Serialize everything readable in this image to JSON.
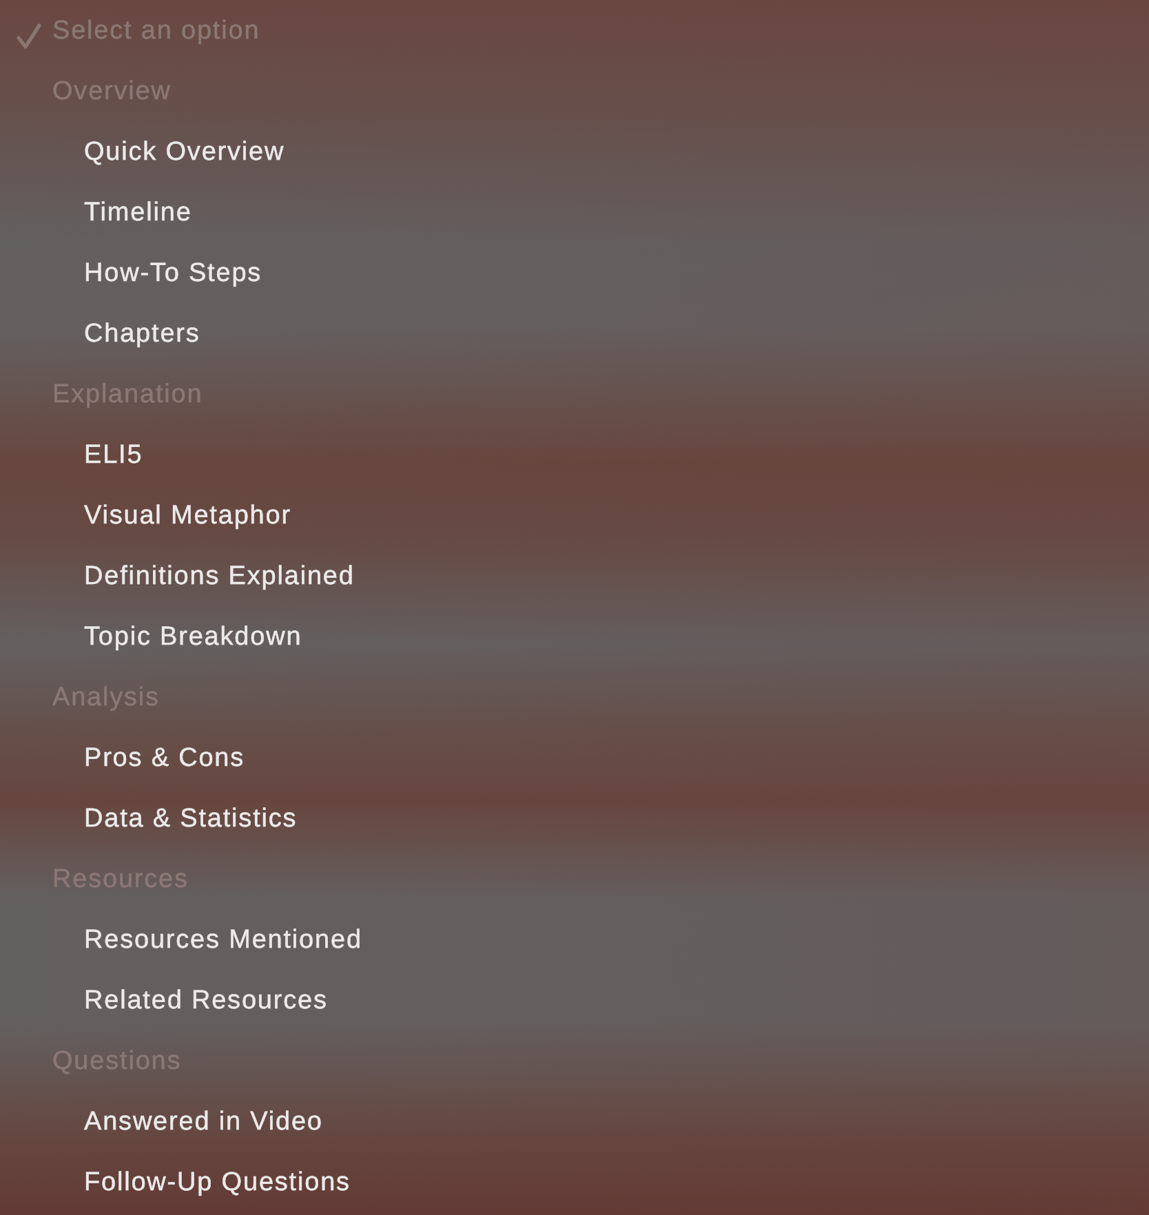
{
  "menu": {
    "placeholder": {
      "label": "Select an option",
      "selected": true,
      "disabled": true
    },
    "groups": [
      {
        "label": "Overview",
        "options": [
          {
            "label": "Quick Overview",
            "selected": false
          },
          {
            "label": "Timeline",
            "selected": false
          },
          {
            "label": "How-To Steps",
            "selected": false
          },
          {
            "label": "Chapters",
            "selected": false
          }
        ]
      },
      {
        "label": "Explanation",
        "options": [
          {
            "label": "ELI5",
            "selected": false
          },
          {
            "label": "Visual Metaphor",
            "selected": false
          },
          {
            "label": "Definitions Explained",
            "selected": false
          },
          {
            "label": "Topic Breakdown",
            "selected": false
          }
        ]
      },
      {
        "label": "Analysis",
        "options": [
          {
            "label": "Pros & Cons",
            "selected": false
          },
          {
            "label": "Data & Statistics",
            "selected": false
          }
        ]
      },
      {
        "label": "Resources",
        "options": [
          {
            "label": "Resources Mentioned",
            "selected": false
          },
          {
            "label": "Related Resources",
            "selected": false
          }
        ]
      },
      {
        "label": "Questions",
        "options": [
          {
            "label": "Answered in Video",
            "selected": false
          },
          {
            "label": "Follow-Up Questions",
            "selected": false
          }
        ]
      }
    ]
  }
}
